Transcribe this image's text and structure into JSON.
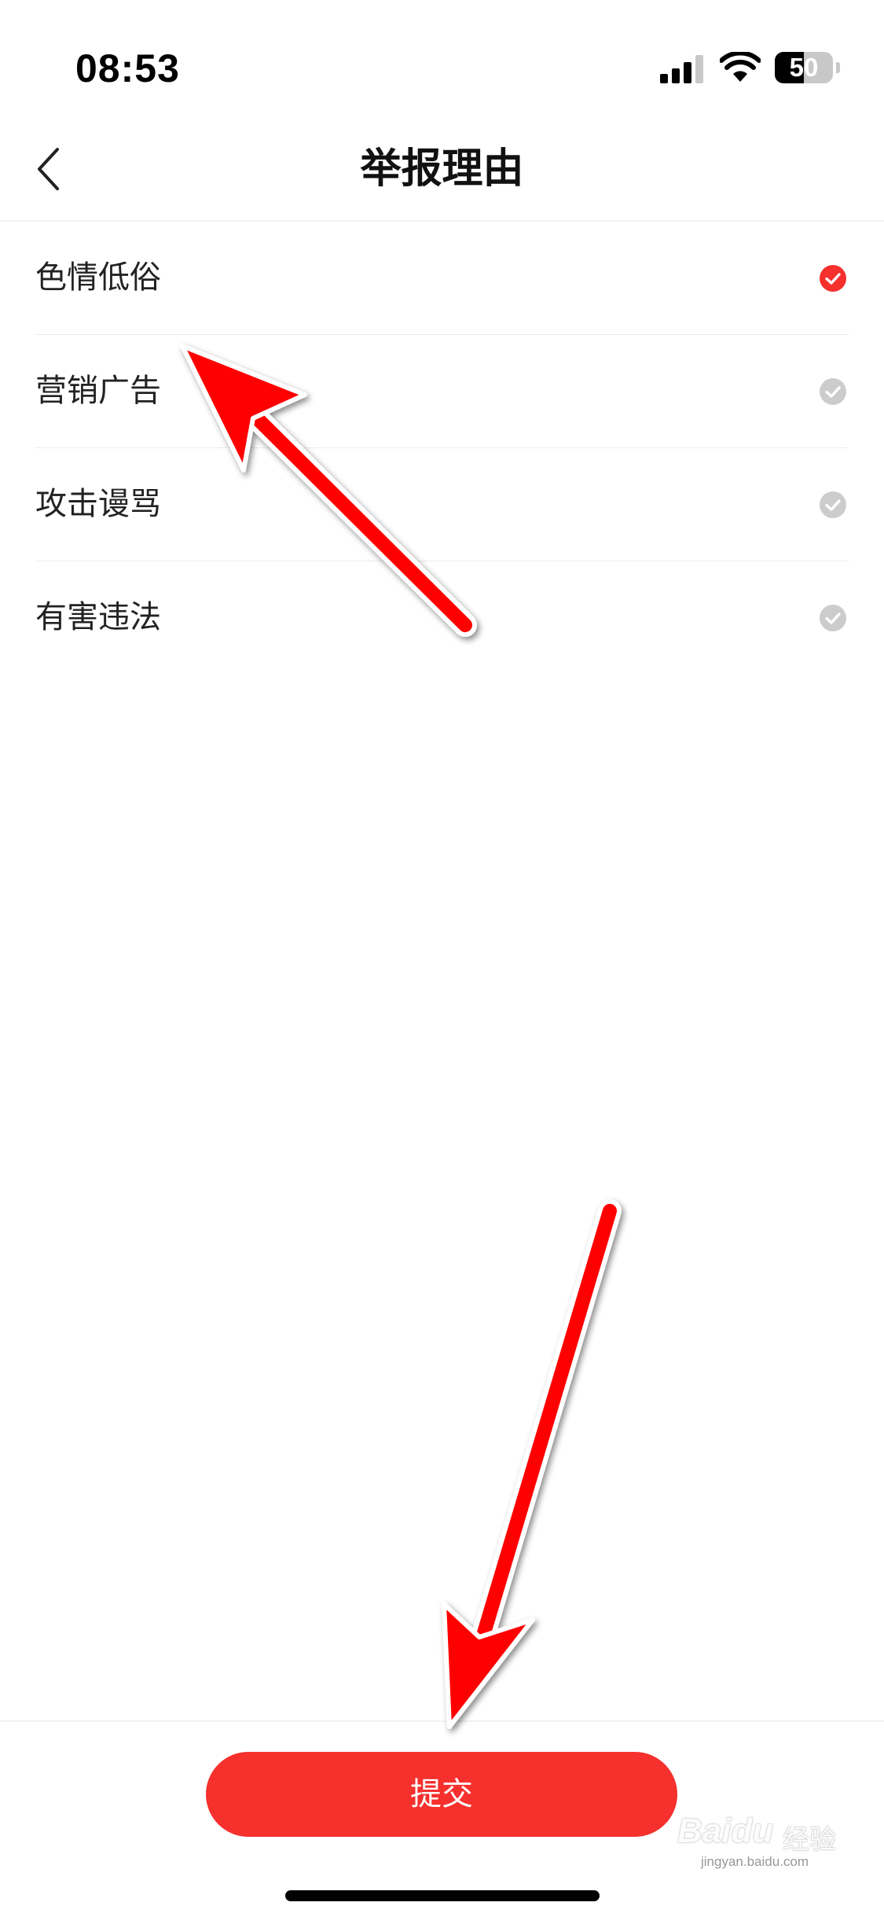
{
  "status_bar": {
    "time": "08:53",
    "battery": "50",
    "battery_level": 0.5
  },
  "header": {
    "back_icon": "chevron-left-icon",
    "title": "举报理由"
  },
  "reasons": [
    {
      "label": "色情低俗",
      "selected": true
    },
    {
      "label": "营销广告",
      "selected": false
    },
    {
      "label": "攻击谩骂",
      "selected": false
    },
    {
      "label": "有害违法",
      "selected": false
    }
  ],
  "footer": {
    "submit_label": "提交"
  },
  "watermark": {
    "brand": "Baidu",
    "product": "经验",
    "url": "jingyan.baidu.com"
  },
  "colors": {
    "accent": "#f5302d",
    "check_inactive": "#cccccc",
    "annotation_arrow": "#ff0000"
  }
}
